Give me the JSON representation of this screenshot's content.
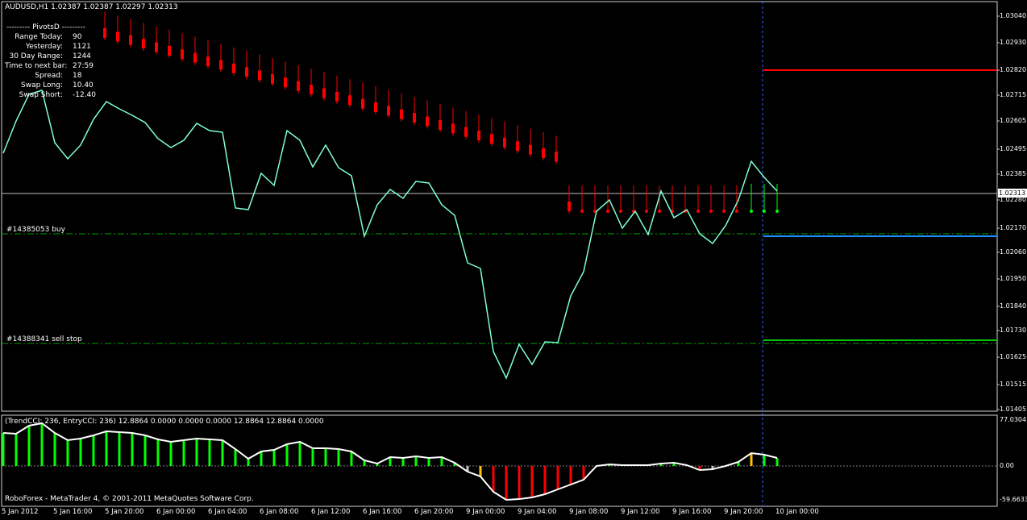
{
  "window": {
    "title": "AUDUSD,H1  1.02387 1.02387 1.02297 1.02313"
  },
  "pivots_panel": {
    "header": "---------   PivotsD   ---------",
    "rows": [
      {
        "label": "Range  Today:",
        "value": "90"
      },
      {
        "label": "Yesterday:",
        "value": "1121"
      },
      {
        "label": "30 Day Range:",
        "value": "1244"
      },
      {
        "label": "Time to next bar:",
        "value": "27:59"
      },
      {
        "label": "Spread:",
        "value": "18"
      },
      {
        "label": "Swap  Long:",
        "value": "10.40"
      },
      {
        "label": "Swap  Short:",
        "value": "-12.40"
      }
    ]
  },
  "orders": {
    "buy_label": "#14385053 buy",
    "sell_stop_label": "#14388341 sell stop"
  },
  "price_axis": {
    "labels": [
      "1.03040",
      "1.02930",
      "1.02820",
      "1.02715",
      "1.02605",
      "1.02495",
      "1.02385",
      "1.02280",
      "1.02170",
      "1.02060",
      "1.01950",
      "1.01840",
      "1.01730",
      "1.01625",
      "1.01515",
      "1.01405"
    ],
    "current_price": "1.02313"
  },
  "indicator": {
    "title": "(TrendCCI: 236, EntryCCI: 236)  12.8864 0.0000 0.0000 0.0000 12.8864 12.8864 0.0000",
    "axis_top": "77.0304",
    "axis_zero": "0.00",
    "axis_bottom": "-59.6633"
  },
  "time_axis": {
    "labels": [
      "5 Jan 2012",
      "5 Jan 16:00",
      "5 Jan 20:00",
      "6 Jan 00:00",
      "6 Jan 04:00",
      "6 Jan 08:00",
      "6 Jan 12:00",
      "6 Jan 16:00",
      "6 Jan 20:00",
      "9 Jan 00:00",
      "9 Jan 04:00",
      "9 Jan 08:00",
      "9 Jan 12:00",
      "9 Jan 16:00",
      "9 Jan 20:00",
      "10 Jan 00:00"
    ]
  },
  "footer": {
    "copyright": "RoboForex - MetaTrader 4, © 2001-2011 MetaQuotes Software Corp."
  },
  "colors": {
    "background": "#000000",
    "bear_bar": "#ff0000",
    "bull_bar": "#00ff00",
    "cci_line": "#7fffd4",
    "indicator_line": "#ffffff",
    "buy_level": "#1e90ff",
    "resistance": "#ff0000",
    "sell_stop": "#00c000",
    "orange": "#ffc000",
    "gray": "#c0c0c0"
  },
  "chart_data": {
    "type": "line",
    "symbol": "AUDUSD",
    "timeframe": "H1",
    "ohlc_header": {
      "open": 1.02387,
      "high": 1.02387,
      "low": 1.02297,
      "close": 1.02313
    },
    "ylim": [
      1.01405,
      1.0304
    ],
    "levels": {
      "current": 1.02313,
      "buy": 1.0213,
      "sell_stop": 1.0169,
      "upper": 1.0282
    }
  }
}
